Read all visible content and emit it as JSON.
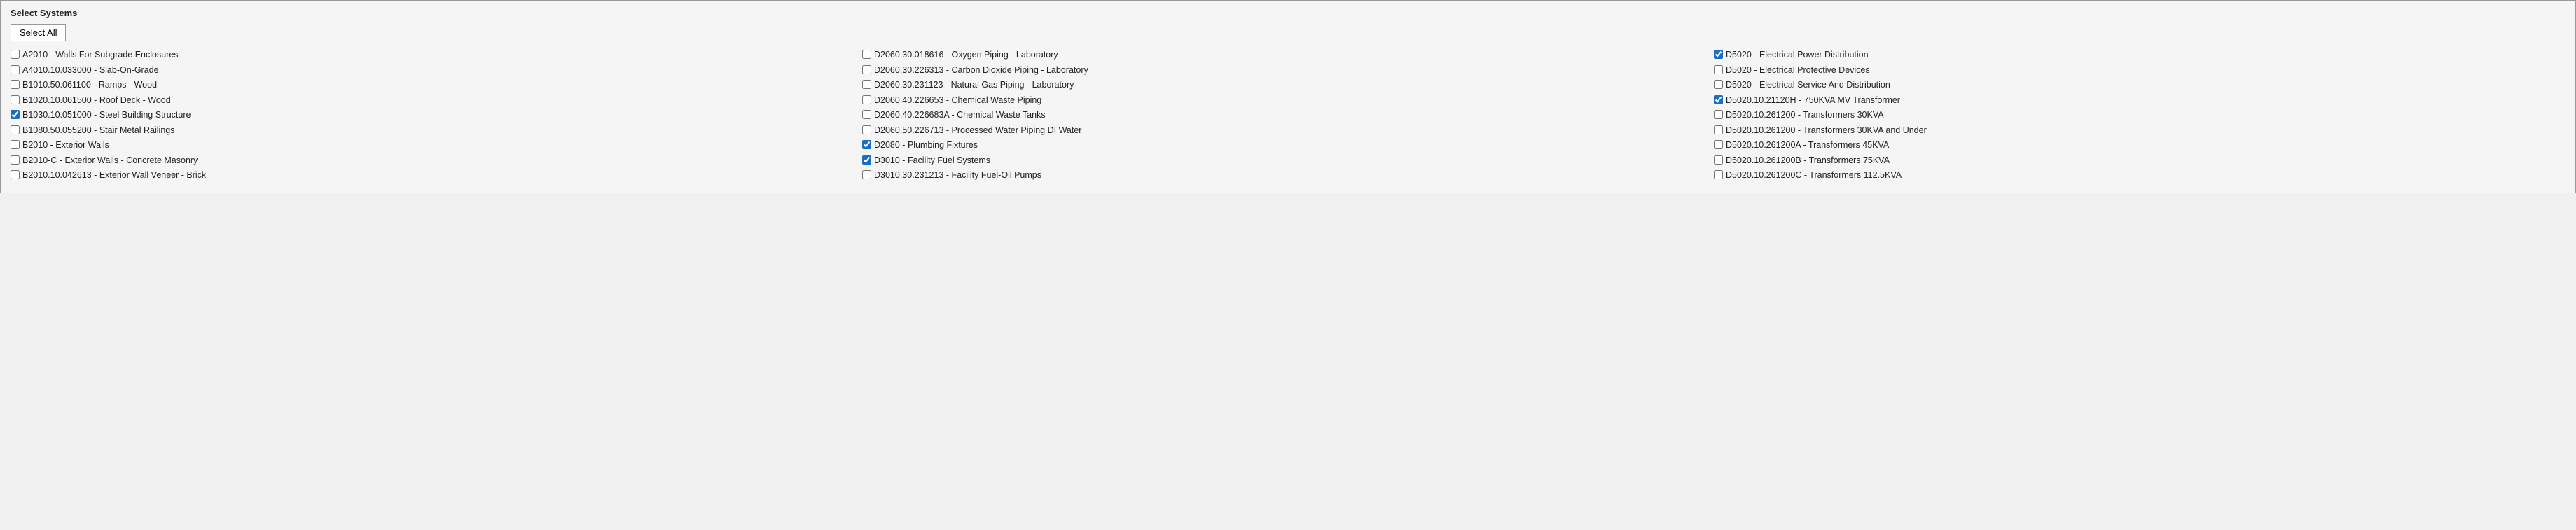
{
  "panel": {
    "title": "Select Systems",
    "select_all_label": "Select All"
  },
  "columns": [
    {
      "items": [
        {
          "id": "A2010",
          "label": "A2010 - Walls For Subgrade Enclosures",
          "checked": false
        },
        {
          "id": "A4010",
          "label": "A4010.10.033000 - Slab-On-Grade",
          "checked": false
        },
        {
          "id": "B1010_50",
          "label": "B1010.50.061100 - Ramps - Wood",
          "checked": false
        },
        {
          "id": "B1020",
          "label": "B1020.10.061500 - Roof Deck - Wood",
          "checked": false
        },
        {
          "id": "B1030",
          "label": "B1030.10.051000 - Steel Building Structure",
          "checked": true
        },
        {
          "id": "B1080",
          "label": "B1080.50.055200 - Stair Metal Railings",
          "checked": false
        },
        {
          "id": "B2010",
          "label": "B2010 - Exterior Walls",
          "checked": false
        },
        {
          "id": "B2010C",
          "label": "B2010-C - Exterior Walls - Concrete Masonry",
          "checked": false
        },
        {
          "id": "B2010_042613",
          "label": "B2010.10.042613 - Exterior Wall Veneer - Brick",
          "checked": false
        }
      ]
    },
    {
      "items": [
        {
          "id": "D2060_018616",
          "label": "D2060.30.018616 - Oxygen Piping - Laboratory",
          "checked": false
        },
        {
          "id": "D2060_226313",
          "label": "D2060.30.226313 - Carbon Dioxide Piping - Laboratory",
          "checked": false
        },
        {
          "id": "D2060_231123",
          "label": "D2060.30.231123 - Natural Gas Piping - Laboratory",
          "checked": false
        },
        {
          "id": "D2060_226653",
          "label": "D2060.40.226653 - Chemical Waste Piping",
          "checked": false
        },
        {
          "id": "D2060_226683A",
          "label": "D2060.40.226683A - Chemical Waste Tanks",
          "checked": false
        },
        {
          "id": "D2060_226713",
          "label": "D2060.50.226713 - Processed Water Piping DI Water",
          "checked": false
        },
        {
          "id": "D2080",
          "label": "D2080 - Plumbing Fixtures",
          "checked": true
        },
        {
          "id": "D3010",
          "label": "D3010 - Facility Fuel Systems",
          "checked": true
        },
        {
          "id": "D3010_231213",
          "label": "D3010.30.231213 - Facility Fuel-Oil Pumps",
          "checked": false
        }
      ]
    },
    {
      "items": [
        {
          "id": "D5020",
          "label": "D5020 - Electrical Power Distribution",
          "checked": true
        },
        {
          "id": "D5020_protective",
          "label": "D5020 - Electrical Protective Devices",
          "checked": false
        },
        {
          "id": "D5020_service",
          "label": "D5020 - Electrical Service And Distribution",
          "checked": false
        },
        {
          "id": "D5020_21120H",
          "label": "D5020.10.21120H - 750KVA MV Transformer",
          "checked": true
        },
        {
          "id": "D5020_261200",
          "label": "D5020.10.261200 - Transformers 30KVA",
          "checked": false
        },
        {
          "id": "D5020_261200_under",
          "label": "D5020.10.261200 - Transformers 30KVA and Under",
          "checked": false
        },
        {
          "id": "D5020_261200A",
          "label": "D5020.10.261200A - Transformers 45KVA",
          "checked": false
        },
        {
          "id": "D5020_261200B",
          "label": "D5020.10.261200B - Transformers 75KVA",
          "checked": false
        },
        {
          "id": "D5020_261200C",
          "label": "D5020.10.261200C - Transformers 112.5KVA",
          "checked": false
        }
      ]
    }
  ]
}
